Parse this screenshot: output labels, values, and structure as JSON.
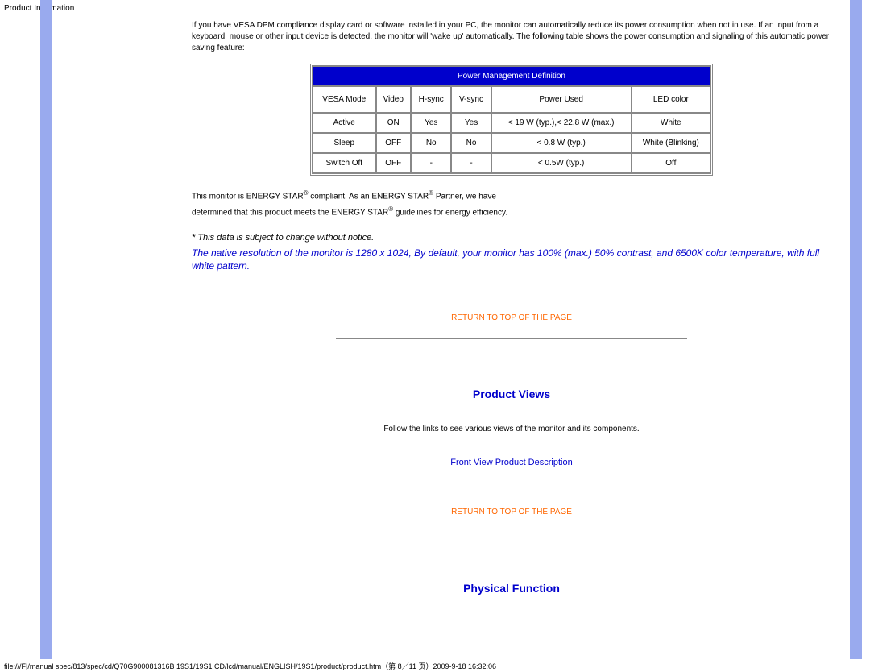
{
  "header_label": "Product Information",
  "intro": "If you have VESA DPM compliance display card or software installed in your PC, the monitor can automatically reduce its power consumption when not in use. If an input from a keyboard, mouse or other input device is detected, the monitor will 'wake up' automatically. The following table shows the power consumption and signaling of this automatic power saving feature:",
  "table": {
    "title": "Power Management Definition",
    "headers": [
      "VESA Mode",
      "Video",
      "H-sync",
      "V-sync",
      "Power Used",
      "LED color"
    ],
    "rows": [
      [
        "Active",
        "ON",
        "Yes",
        "Yes",
        "< 19 W (typ.),< 22.8 W (max.)",
        "White"
      ],
      [
        "Sleep",
        "OFF",
        "No",
        "No",
        "< 0.8 W (typ.)",
        "White (Blinking)"
      ],
      [
        "Switch Off",
        "OFF",
        "-",
        "-",
        "< 0.5W (typ.)",
        "Off"
      ]
    ]
  },
  "compliance": {
    "part1": "This monitor is ENERGY STAR",
    "part2": " compliant. As an ENERGY STAR",
    "part3": " Partner, we have",
    "part4": "determined that this product meets the ENERGY STAR",
    "part5": " guidelines for energy efficiency."
  },
  "notice1": "* This data is subject to change without notice.",
  "notice2": "The native resolution of the monitor is 1280 x 1024, By default, your monitor has 100% (max.) 50% contrast, and 6500K color temperature, with full white pattern.",
  "return_link": "RETURN TO TOP OF THE PAGE",
  "sections": {
    "views": {
      "heading": "Product Views",
      "text": "Follow the links to see various views of the monitor and its components.",
      "link": "Front View Product Description"
    },
    "physical": {
      "heading": "Physical Function"
    }
  },
  "footer_path": "file:///F|/manual spec/813/spec/cd/Q70G900081316B 19S1/19S1 CD/lcd/manual/ENGLISH/19S1/product/product.htm（第 8／11 页）2009-9-18 16:32:06"
}
